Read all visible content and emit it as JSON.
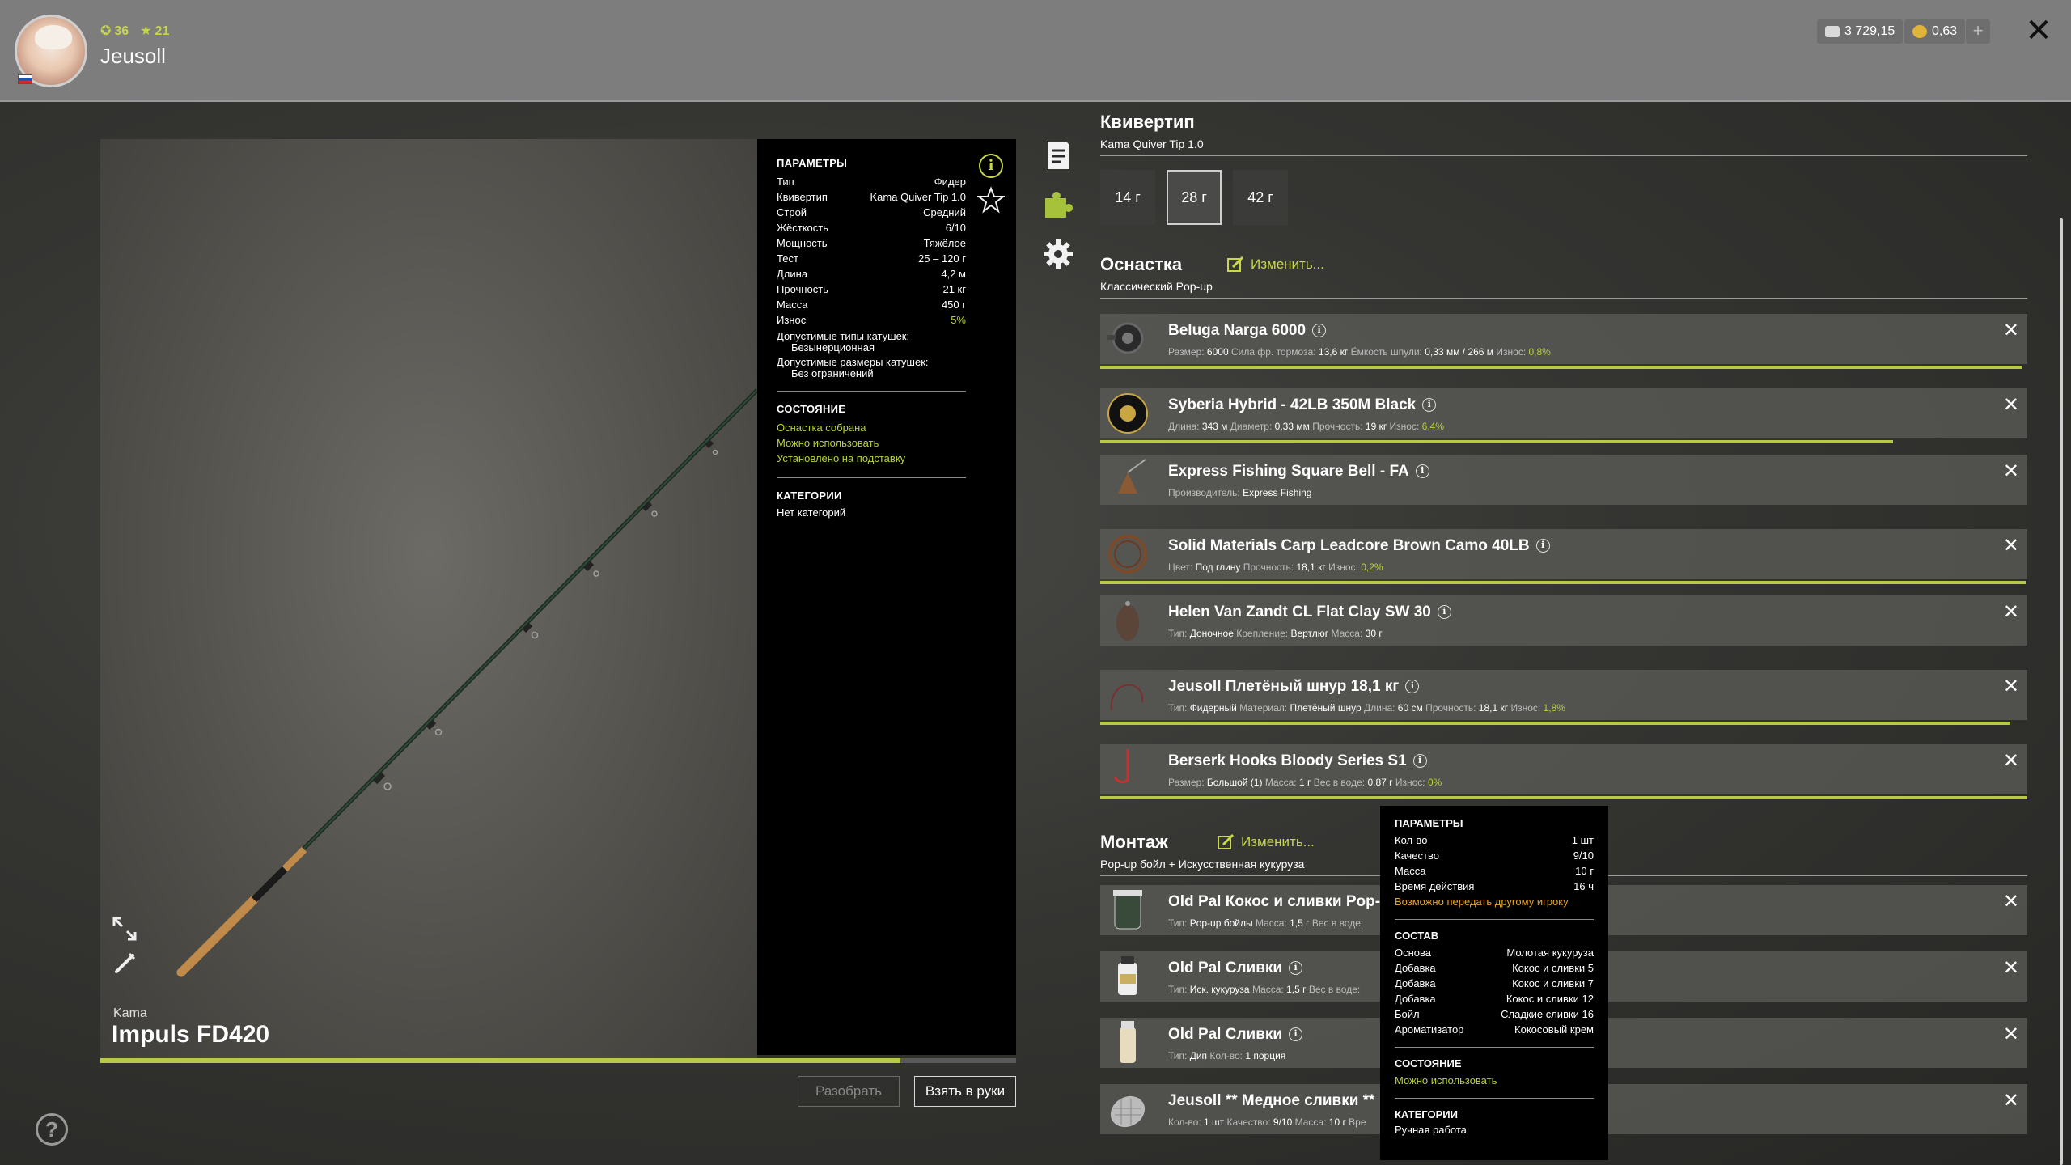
{
  "player": {
    "name": "Jeusoll",
    "level": "36",
    "rank": "21"
  },
  "currency": {
    "silver": "3 729,15",
    "gold": "0,63",
    "add_label": "+"
  },
  "rod": {
    "brand": "Kama",
    "name": "Impuls FD420",
    "wear_progress": 0.874
  },
  "params": {
    "title": "ПАРАМЕТРЫ",
    "rows": [
      {
        "k": "Тип",
        "v": "Фидер"
      },
      {
        "k": "Квивертип",
        "v": "Kama Quiver Tip 1.0"
      },
      {
        "k": "Строй",
        "v": "Средний"
      },
      {
        "k": "Жёсткость",
        "v": "6/10"
      },
      {
        "k": "Мощность",
        "v": "Тяжёлое"
      },
      {
        "k": "Тест",
        "v": "25 – 120 г"
      },
      {
        "k": "Длина",
        "v": "4,2 м"
      },
      {
        "k": "Прочность",
        "v": "21 кг"
      },
      {
        "k": "Масса",
        "v": "450 г"
      },
      {
        "k": "Износ",
        "v": "5%"
      }
    ],
    "reel_types_label": "Допустимые типы катушек:",
    "reel_types_value": "Безынерционная",
    "reel_sizes_label": "Допустимые размеры катушек:",
    "reel_sizes_value": "Без ограничений",
    "state_title": "СОСТОЯНИЕ",
    "state_items": [
      "Оснастка собрана",
      "Можно использовать",
      "Установлено на подставку"
    ],
    "cat_title": "КАТЕГОРИИ",
    "cat_value": "Нет категорий"
  },
  "buttons": {
    "disassemble": "Разобрать",
    "take": "Взять в руки"
  },
  "quiver": {
    "title": "Квивертип",
    "subtitle": "Kama Quiver Tip 1.0",
    "options": [
      "14 г",
      "28 г",
      "42 г"
    ],
    "selected": "28 г"
  },
  "tackle": {
    "title": "Оснастка",
    "change": "Изменить...",
    "subtitle": "Классический Pop-up",
    "items": [
      {
        "name": "Beluga Narga 6000",
        "details": [
          [
            "Размер:",
            "6000"
          ],
          [
            "Сила фр. тормоза:",
            "13,6 кг"
          ],
          [
            "Ёмкость шпули:",
            "0,33 мм / 266 м"
          ],
          [
            "Износ:",
            "0,8%"
          ]
        ],
        "wear": 0.995
      },
      {
        "name": "Syberia Hybrid - 42LB 350M Black",
        "details": [
          [
            "Длина:",
            "343 м"
          ],
          [
            "Диаметр:",
            "0,33 мм"
          ],
          [
            "Прочность:",
            "19 кг"
          ],
          [
            "Износ:",
            "6,4%"
          ]
        ],
        "wear": 0.855
      },
      {
        "name": "Express Fishing Square Bell - FA",
        "details": [
          [
            "Производитель:",
            "Express Fishing"
          ]
        ],
        "wear": null
      },
      {
        "name": "Solid Materials Carp Leadcore Brown Camo 40LB",
        "details": [
          [
            "Цвет:",
            "Под глину"
          ],
          [
            "Прочность:",
            "18,1 кг"
          ],
          [
            "Износ:",
            "0,2%"
          ]
        ],
        "wear": 0.998
      },
      {
        "name": "Helen Van Zandt CL Flat Clay SW 30",
        "details": [
          [
            "Тип:",
            "Доночное"
          ],
          [
            "Крепление:",
            "Вертлюг"
          ],
          [
            "Масса:",
            "30 г"
          ]
        ],
        "wear": null
      },
      {
        "name": "Jeusoll Плетёный шнур 18,1 кг",
        "details": [
          [
            "Тип:",
            "Фидерный"
          ],
          [
            "Материал:",
            "Плетёный шнур"
          ],
          [
            "Длина:",
            "60 см"
          ],
          [
            "Прочность:",
            "18,1 кг"
          ],
          [
            "Износ:",
            "1,8%"
          ]
        ],
        "wear": 0.982
      },
      {
        "name": "Berserk Hooks Bloody Series S1",
        "details": [
          [
            "Размер:",
            "Большой (1)"
          ],
          [
            "Масса:",
            "1 г"
          ],
          [
            "Вес в воде:",
            "0,87 г"
          ],
          [
            "Износ:",
            "0%"
          ]
        ],
        "wear": 1.0
      }
    ]
  },
  "montage": {
    "title": "Монтаж",
    "change": "Изменить...",
    "subtitle": "Pop-up бойл + Искусственная кукуруза",
    "items": [
      {
        "name": "Old Pal Кокос и сливки Pop-Up",
        "details": [
          [
            "Тип:",
            "Pop-up бойлы"
          ],
          [
            "Масса:",
            "1,5 г"
          ],
          [
            "Вес в воде:",
            ""
          ]
        ]
      },
      {
        "name": "Old Pal Сливки",
        "details": [
          [
            "Тип:",
            "Иск. кукуруза"
          ],
          [
            "Масса:",
            "1,5 г"
          ],
          [
            "Вес в воде:",
            ""
          ]
        ]
      },
      {
        "name": "Old Pal Сливки",
        "details": [
          [
            "Тип:",
            "Дип"
          ],
          [
            "Кол-во:",
            "1 порция"
          ]
        ]
      },
      {
        "name": "Jeusoll ** Медное сливки **",
        "details": [
          [
            "Кол-во:",
            "1 шт"
          ],
          [
            "Качество:",
            "9/10"
          ],
          [
            "Масса:",
            "10 г"
          ],
          [
            "Вре",
            ""
          ]
        ]
      }
    ]
  },
  "tooltip": {
    "params_title": "ПАРАМЕТРЫ",
    "params": [
      {
        "k": "Кол-во",
        "v": "1 шт"
      },
      {
        "k": "Качество",
        "v": "9/10"
      },
      {
        "k": "Масса",
        "v": "10 г"
      },
      {
        "k": "Время действия",
        "v": "16 ч"
      }
    ],
    "transfer_note": "Возможно передать другому игроку",
    "composition_title": "СОСТАВ",
    "composition": [
      {
        "k": "Основа",
        "v": "Молотая кукуруза"
      },
      {
        "k": "Добавка",
        "v": "Кокос и сливки 5"
      },
      {
        "k": "Добавка",
        "v": "Кокос и сливки 7"
      },
      {
        "k": "Добавка",
        "v": "Кокос и сливки 12"
      },
      {
        "k": "Бойл",
        "v": "Сладкие сливки 16"
      },
      {
        "k": "Ароматизатор",
        "v": "Кокосовый крем"
      }
    ],
    "state_title": "СОСТОЯНИЕ",
    "state_value": "Можно использовать",
    "cat_title": "КАТЕГОРИИ",
    "cat_value": "Ручная работа"
  },
  "colors": {
    "accent": "#b9d03a",
    "warning": "#e9a52a"
  },
  "icons": [
    "notes-icon",
    "puzzle-icon",
    "gear-icon",
    "info-icon",
    "star-icon",
    "expand-icon",
    "brush-icon",
    "help-icon",
    "close-icon",
    "edit-icon"
  ]
}
